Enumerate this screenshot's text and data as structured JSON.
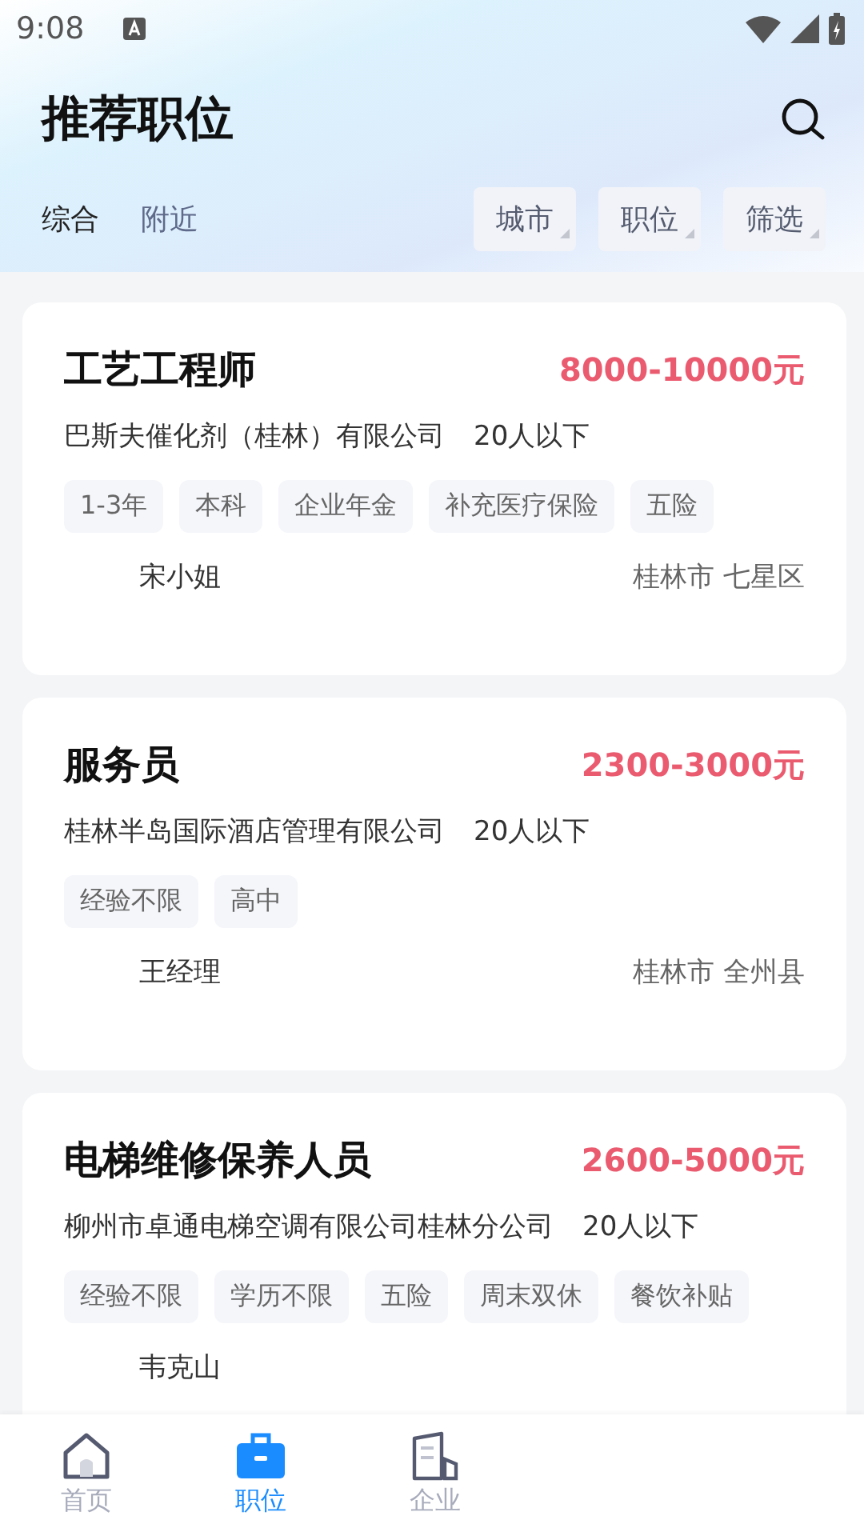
{
  "status_bar": {
    "time": "9:08"
  },
  "header": {
    "title": "推荐职位"
  },
  "tabs": [
    {
      "label": "综合",
      "selected": true
    },
    {
      "label": "附近",
      "selected": false
    }
  ],
  "filters": [
    "城市",
    "职位",
    "筛选"
  ],
  "jobs": [
    {
      "title": "工艺工程师",
      "salary": "8000-10000元",
      "company": "巴斯夫催化剂（桂林）有限公司",
      "size": "20人以下",
      "tags": [
        "1-3年",
        "本科",
        "企业年金",
        "补充医疗保险",
        "五险"
      ],
      "contact": "宋小姐",
      "location": "桂林市 七星区"
    },
    {
      "title": "服务员",
      "salary": "2300-3000元",
      "company": "桂林半岛国际酒店管理有限公司",
      "size": "20人以下",
      "tags": [
        "经验不限",
        "高中"
      ],
      "contact": "王经理",
      "location": "桂林市 全州县"
    },
    {
      "title": "电梯维修保养人员",
      "salary": "2600-5000元",
      "company": "柳州市卓通电梯空调有限公司桂林分公司",
      "size": "20人以下",
      "tags": [
        "经验不限",
        "学历不限",
        "五险",
        "周末双休",
        "餐饮补贴"
      ],
      "contact": "韦克山"
    }
  ],
  "nav": [
    {
      "kind": "home",
      "label": "首页",
      "selected": false
    },
    {
      "kind": "jobs",
      "label": "职位",
      "selected": true
    },
    {
      "kind": "company",
      "label": "企业",
      "selected": false
    }
  ]
}
